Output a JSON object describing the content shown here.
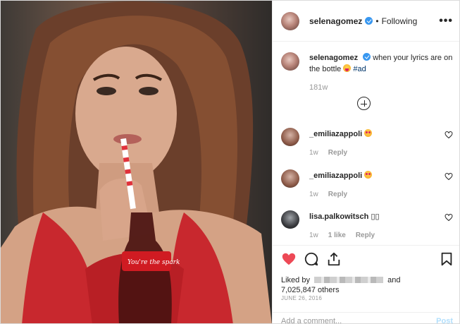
{
  "post": {
    "author": "selenagomez",
    "dot": "•",
    "follow_status": "Following",
    "more_label": "•••",
    "caption_text": " when your lyrics are on the bottle ",
    "hashtag": "#ad",
    "caption_age": "181w"
  },
  "comments": [
    {
      "user": "_emiliazappoli",
      "age": "1w",
      "likes": "",
      "reply": "Reply",
      "emoji": "heart-eyes"
    },
    {
      "user": "_emiliazappoli",
      "age": "1w",
      "likes": "",
      "reply": "Reply",
      "emoji": "heart-eyes"
    },
    {
      "user": "lisa.palkowitsch",
      "suffix": "▯▯",
      "age": "1w",
      "likes": "1 like",
      "reply": "Reply"
    }
  ],
  "footer": {
    "liked_prefix": "Liked by",
    "liked_and": "and",
    "liked_count": "7,025,847 others",
    "date": "JUNE 26, 2016",
    "comment_placeholder": "Add a comment...",
    "post_button": "Post"
  },
  "photo": {
    "bottle_text": "You're the spark"
  },
  "colors": {
    "heart": "#ed4956",
    "verified": "#3897f0",
    "dress": "#c8282e"
  }
}
